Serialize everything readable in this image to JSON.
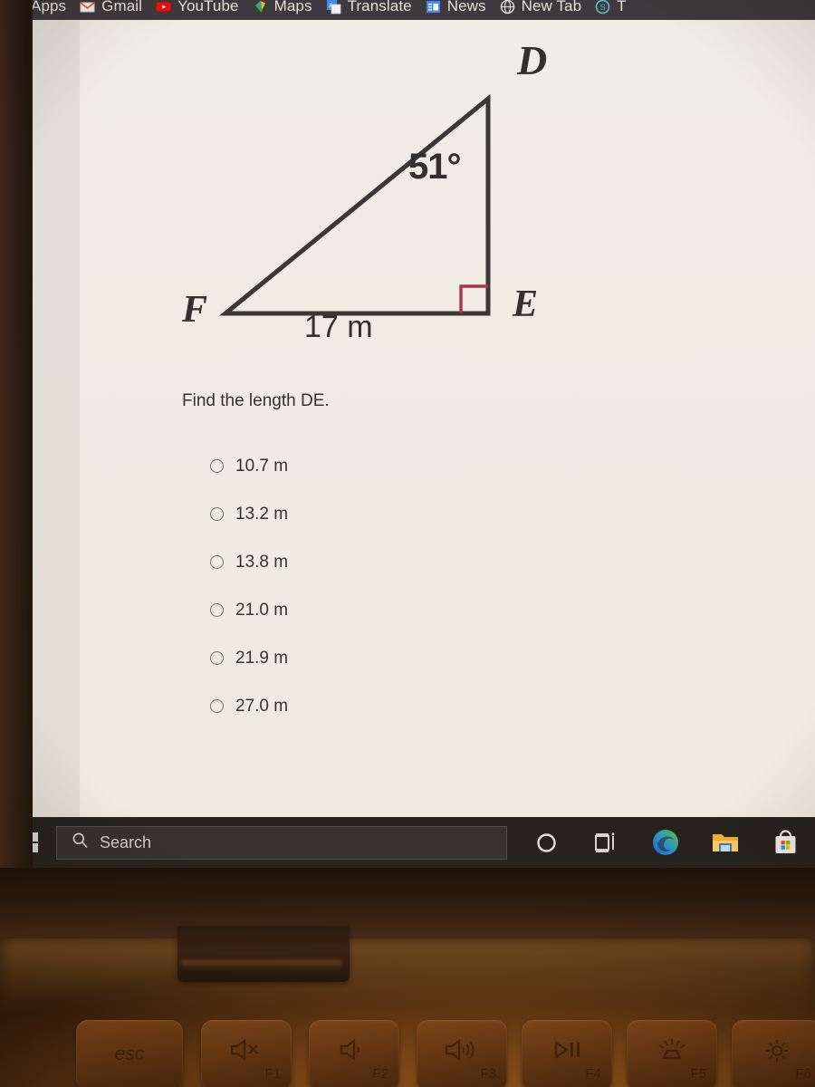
{
  "browser": {
    "bookmarks": [
      {
        "label": "Apps",
        "icon": "apps-grid-icon"
      },
      {
        "label": "Gmail",
        "icon": "gmail-icon"
      },
      {
        "label": "YouTube",
        "icon": "youtube-icon"
      },
      {
        "label": "Maps",
        "icon": "google-maps-pin-icon"
      },
      {
        "label": "Translate",
        "icon": "google-translate-icon"
      },
      {
        "label": "News",
        "icon": "google-news-icon"
      },
      {
        "label": "New Tab",
        "icon": "globe-icon"
      },
      {
        "label": "T",
        "icon": "circle-s-icon"
      }
    ]
  },
  "figure": {
    "vertex_D": "D",
    "vertex_E": "E",
    "vertex_F": "F",
    "angle_at_D": "51°",
    "side_FE": "17 m",
    "right_angle_at": "E",
    "right_angle_color": "#a23149",
    "line_color": "#333333"
  },
  "question": {
    "prompt": "Find the length DE.",
    "choices": [
      {
        "label": "10.7 m",
        "selected": false
      },
      {
        "label": "13.2 m",
        "selected": false
      },
      {
        "label": "13.8 m",
        "selected": false
      },
      {
        "label": "21.0 m",
        "selected": false
      },
      {
        "label": "21.9 m",
        "selected": false
      },
      {
        "label": "27.0 m",
        "selected": false
      }
    ]
  },
  "taskbar": {
    "start_icon": "windows-start-icon",
    "search": {
      "placeholder": "Search",
      "icon": "search-icon"
    },
    "icons": [
      {
        "name": "cortana-icon"
      },
      {
        "name": "task-view-icon"
      },
      {
        "name": "microsoft-edge-icon"
      },
      {
        "name": "file-explorer-icon"
      },
      {
        "name": "microsoft-store-icon"
      }
    ]
  },
  "keyboard": {
    "keys": [
      {
        "main": "esc",
        "fn": "",
        "glyph": ""
      },
      {
        "main": "",
        "fn": "F1",
        "glyph": "mute-volume-icon"
      },
      {
        "main": "",
        "fn": "F2",
        "glyph": "volume-down-icon"
      },
      {
        "main": "",
        "fn": "F3",
        "glyph": "volume-up-icon"
      },
      {
        "main": "",
        "fn": "F4",
        "glyph": "play-pause-icon"
      },
      {
        "main": "",
        "fn": "F5",
        "glyph": "keyboard-backlight-icon"
      },
      {
        "main": "",
        "fn": "F6",
        "glyph": "brightness-icon"
      }
    ]
  }
}
